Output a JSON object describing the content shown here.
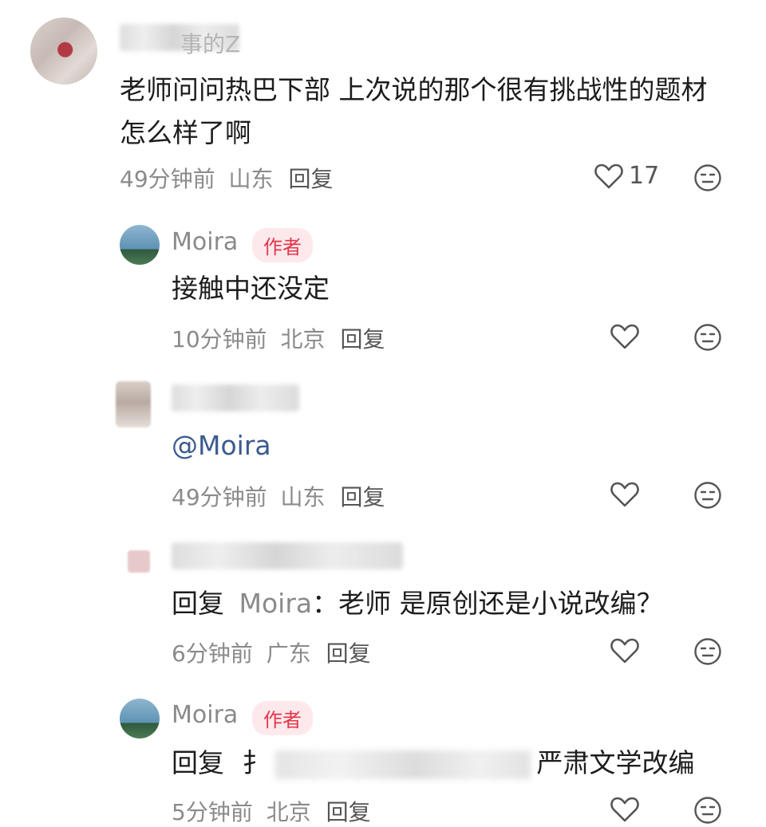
{
  "comments": [
    {
      "name_partial": "事的Z",
      "body": "老师问问热巴下部 上次说的那个很有挑战性的题材怎么样了啊",
      "time": "49分钟前",
      "location": "山东",
      "reply_label": "回复",
      "likes": "17"
    },
    {
      "name": "Moira",
      "badge": "作者",
      "body": "接触中还没定",
      "time": "10分钟前",
      "location": "北京",
      "reply_label": "回复"
    },
    {
      "body": "@Moira",
      "time": "49分钟前",
      "location": "山东",
      "reply_label": "回复"
    },
    {
      "body_prefix": "回复",
      "body_target": "Moira",
      "body_text": "：老师 是原创还是小说改编？",
      "time": "6分钟前",
      "location": "广东",
      "reply_label": "回复"
    },
    {
      "name": "Moira",
      "badge": "作者",
      "body_prefix": "回复",
      "body_lead": "扌",
      "body_text": "严肃文学改编",
      "time": "5分钟前",
      "location": "北京",
      "reply_label": "回复"
    }
  ],
  "icons": {
    "like": "heart-outline-icon",
    "emoji": "neutral-face-icon"
  },
  "colors": {
    "badge_text": "#e5354a",
    "badge_bg": "#fde9ec",
    "meta_text": "#8a8a8a",
    "mention": "#3b5b8f"
  }
}
